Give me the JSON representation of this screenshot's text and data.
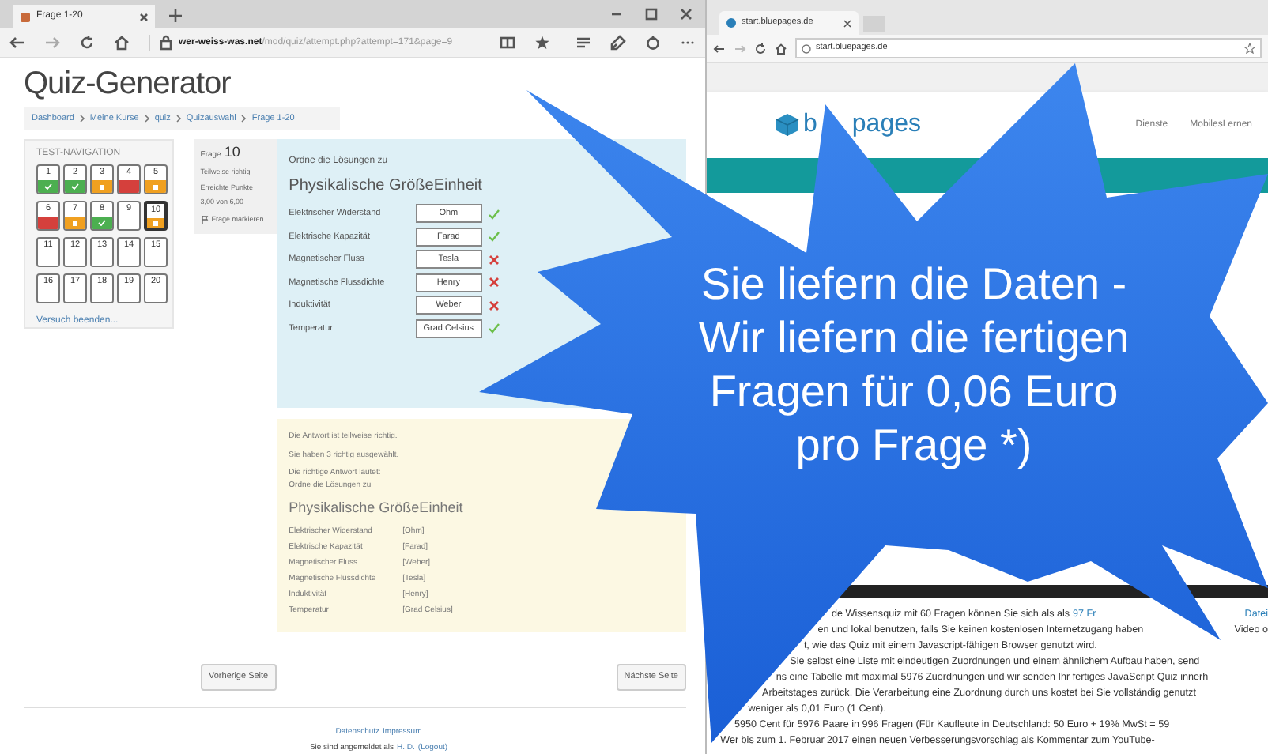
{
  "left_window": {
    "tab": {
      "title": "Frage 1-20"
    },
    "address": {
      "host": "wer-weiss-was.net",
      "path": "/mod/quiz/attempt.php?attempt=171&page=9"
    },
    "page_title": "Quiz-Generator",
    "breadcrumb": [
      "Dashboard",
      "Meine Kurse",
      "quiz",
      "Quizauswahl",
      "Frage 1-20"
    ],
    "navigation": {
      "title": "TEST-NAVIGATION",
      "questions": [
        {
          "number": "1",
          "kind": "correct",
          "current": false
        },
        {
          "number": "2",
          "kind": "correct",
          "current": false
        },
        {
          "number": "3",
          "kind": "partial",
          "current": false
        },
        {
          "number": "4",
          "kind": "wrong",
          "current": false
        },
        {
          "number": "5",
          "kind": "partial",
          "current": false
        },
        {
          "number": "6",
          "kind": "wrong",
          "current": false
        },
        {
          "number": "7",
          "kind": "partial",
          "current": false
        },
        {
          "number": "8",
          "kind": "correct",
          "current": false
        },
        {
          "number": "9",
          "kind": "unanswered",
          "current": false
        },
        {
          "number": "10",
          "kind": "partial",
          "current": true
        },
        {
          "number": "11",
          "kind": "unanswered",
          "current": false
        },
        {
          "number": "12",
          "kind": "unanswered",
          "current": false
        },
        {
          "number": "13",
          "kind": "unanswered",
          "current": false
        },
        {
          "number": "14",
          "kind": "unanswered",
          "current": false
        },
        {
          "number": "15",
          "kind": "unanswered",
          "current": false
        },
        {
          "number": "16",
          "kind": "unanswered",
          "current": false
        },
        {
          "number": "17",
          "kind": "unanswered",
          "current": false
        },
        {
          "number": "18",
          "kind": "unanswered",
          "current": false
        },
        {
          "number": "19",
          "kind": "unanswered",
          "current": false
        },
        {
          "number": "20",
          "kind": "unanswered",
          "current": false
        }
      ],
      "finish_link": "Versuch beenden..."
    },
    "question_info": {
      "label": "Frage",
      "number": "10",
      "state": "Teilweise richtig",
      "points_label": "Erreichte Punkte",
      "points": "3,00 von 6,00",
      "flag": "Frage markieren"
    },
    "question": {
      "prompt": "Ordne die Lösungen zu",
      "heading": "Physikalische GrößeEinheit",
      "rows": [
        {
          "label": "Elektrischer Widerstand",
          "answer": "Ohm",
          "correct": true
        },
        {
          "label": "Elektrische Kapazität",
          "answer": "Farad",
          "correct": true
        },
        {
          "label": "Magnetischer Fluss",
          "answer": "Tesla",
          "correct": false
        },
        {
          "label": "Magnetische Flussdichte",
          "answer": "Henry",
          "correct": false
        },
        {
          "label": "Induktivität",
          "answer": "Weber",
          "correct": false
        },
        {
          "label": "Temperatur",
          "answer": "Grad Celsius",
          "correct": true
        }
      ]
    },
    "feedback": {
      "lines": [
        "Die Antwort ist teilweise richtig.",
        "Sie haben 3 richtig ausgewählt."
      ],
      "answer_intro": "Die richtige Antwort lautet:",
      "prompt": "Ordne die Lösungen zu",
      "heading": "Physikalische GrößeEinheit",
      "rows": [
        {
          "label": "Elektrischer Widerstand",
          "answer": "[Ohm]"
        },
        {
          "label": "Elektrische Kapazität",
          "answer": "[Farad]"
        },
        {
          "label": "Magnetischer Fluss",
          "answer": "[Weber]"
        },
        {
          "label": "Magnetische Flussdichte",
          "answer": "[Tesla]"
        },
        {
          "label": "Induktivität",
          "answer": "[Henry]"
        },
        {
          "label": "Temperatur",
          "answer": "[Grad Celsius]"
        }
      ]
    },
    "buttons": {
      "previous": "Vorherige Seite",
      "next": "Nächste Seite"
    },
    "footer": {
      "links": [
        "Datenschutz",
        "Impressum"
      ],
      "login_text": "Sie sind angemeldet als",
      "user": "H. D.",
      "logout": "(Logout)"
    }
  },
  "right_window": {
    "tab": {
      "title": "start.bluepages.de"
    },
    "address": "start.bluepages.de",
    "logo_parts": [
      "b",
      "pages"
    ],
    "nav": [
      "Dienste",
      "MobilesLernen"
    ],
    "body_lines": [
      {
        "left": [
          {
            "kind": "text",
            "text": "de Wissensquiz mit 60 Fragen können Sie sich als als"
          },
          {
            "kind": "link",
            "text": "97 Fr"
          }
        ],
        "right": {
          "kind": "link",
          "text": "Datei"
        }
      },
      {
        "left": [
          {
            "kind": "text",
            "text": "en und lokal benutzen, falls Sie keinen kostenlosen Internetzugang haben"
          }
        ],
        "right": {
          "kind": "text",
          "text": "Video o"
        }
      },
      {
        "left": [
          {
            "kind": "text",
            "text": "t, wie das Quiz mit einem Javascript-fähigen Browser genutzt wird."
          }
        ]
      },
      {
        "left": [
          {
            "kind": "text",
            "text": "Sie selbst eine Liste mit eindeutigen Zuordnungen und einem ähnlichem Aufbau haben, send"
          }
        ]
      },
      {
        "left": [
          {
            "kind": "text",
            "text": "ns eine Tabelle mit maximal 5976 Zuordnungen und wir senden Ihr fertiges JavaScript Quiz innerh"
          }
        ]
      },
      {
        "left": [
          {
            "kind": "text",
            "text": "Arbeitstages zurück. Die Verarbeitung eine Zuordnung durch uns kostet bei Sie vollständig genutzt"
          }
        ]
      },
      {
        "left": [
          {
            "kind": "text",
            "text": "weniger als 0,01 Euro (1 Cent)."
          }
        ]
      },
      {
        "left": [
          {
            "kind": "text",
            "text": "5950 Cent für 5976 Paare in 996 Fragen (Für Kaufleute in Deutschland: 50 Euro + 19% MwSt = 59"
          }
        ]
      },
      {
        "left": [
          {
            "kind": "text",
            "text": "Wer bis zum 1. Februar 2017 einen neuen Verbesserungsvorschlag als Kommentar zum YouTube-"
          }
        ]
      }
    ]
  },
  "overlay": {
    "text_lines": [
      "Sie liefern die Daten -",
      "Wir liefern die fertigen",
      "Fragen für 0,06 Euro",
      "pro Frage *)"
    ]
  }
}
